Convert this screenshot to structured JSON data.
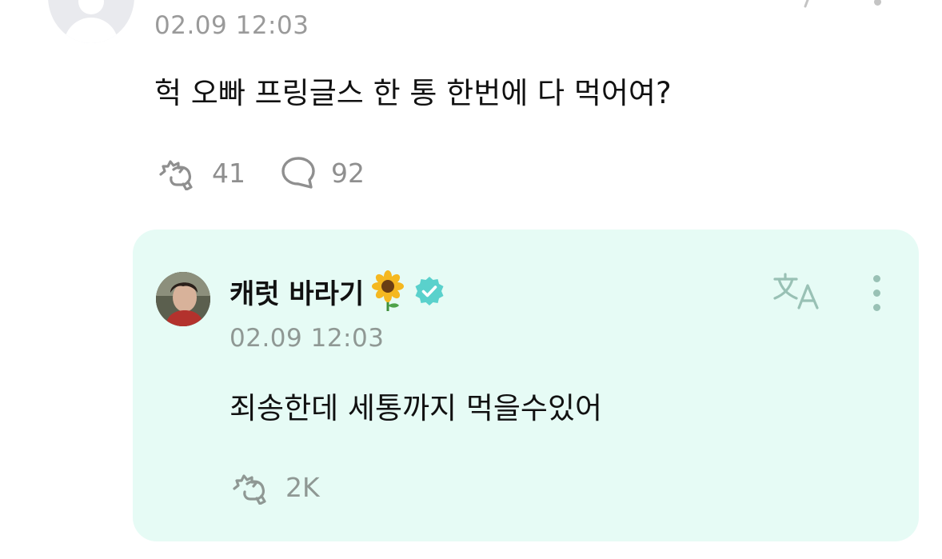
{
  "top_comment": {
    "timestamp": "02.09 12:03",
    "text": "헉 오빠 프링글스 한 통 한번에 다 먹어여?",
    "actions": {
      "like_count": "41",
      "reply_count": "92"
    }
  },
  "reply": {
    "author": "캐럿 바라기",
    "verified": true,
    "timestamp": "02.09 12:03",
    "text": "죄송한데 세통까지 먹을수있어",
    "like_count": "2K"
  },
  "icons": {
    "translate": "translate-icon",
    "more": "more-vertical-icon",
    "like": "like-hand-icon",
    "reply": "speech-bubble-icon",
    "badge": "verified-badge-icon",
    "sunflower": "sunflower-icon"
  },
  "colors": {
    "reply_background": "#e6fbf5",
    "verified_badge": "#5ad1cc",
    "muted_text": "#9a9a9a",
    "reply_icon_tint": "#99c1b5"
  }
}
